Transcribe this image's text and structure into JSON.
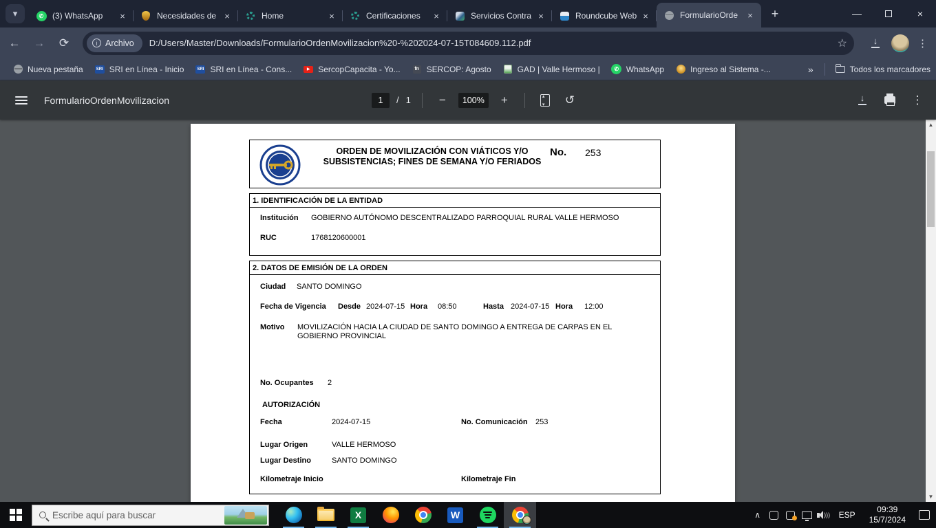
{
  "browser": {
    "tabs": [
      {
        "label": "(3) WhatsApp",
        "icon": "whatsapp"
      },
      {
        "label": "Necesidades de",
        "icon": "ecuador-crest"
      },
      {
        "label": "Home",
        "icon": "teal-gear"
      },
      {
        "label": "Certificaciones",
        "icon": "teal-gear"
      },
      {
        "label": "Servicios Contra",
        "icon": "emblem"
      },
      {
        "label": "Roundcube Web",
        "icon": "roundcube"
      },
      {
        "label": "FormularioOrde",
        "icon": "globe",
        "active": true
      }
    ],
    "address": {
      "chip_label": "Archivo",
      "url": "D:/Users/Master/Downloads/FormularioOrdenMovilizacion%20-%202024-07-15T084609.112.pdf"
    },
    "bookmarks": [
      {
        "label": "Nueva pestaña",
        "icon": "globe"
      },
      {
        "label": "SRI en Línea - Inicio",
        "icon": "sri"
      },
      {
        "label": "SRI en Línea - Cons...",
        "icon": "sri"
      },
      {
        "label": "SercopCapacita - Yo...",
        "icon": "youtube"
      },
      {
        "label": "SERCOP: Agosto",
        "icon": "fn"
      },
      {
        "label": "GAD | Valle Hermoso |",
        "icon": "gad"
      },
      {
        "label": "WhatsApp",
        "icon": "whatsapp"
      },
      {
        "label": "Ingreso al Sistema -...",
        "icon": "ecuador-crest"
      }
    ],
    "bookmarks_overflow": "»",
    "all_bookmarks_label": "Todos los marcadores"
  },
  "pdf_viewer": {
    "title": "FormularioOrdenMovilizacion",
    "page_current": "1",
    "page_divider": "/",
    "page_total": "1",
    "zoom_level": "100%"
  },
  "document": {
    "header": {
      "title": "ORDEN DE MOVILIZACIÓN CON VIÁTICOS Y/O SUBSISTENCIAS; FINES DE SEMANA Y/O FERIADOS",
      "no_label": "No.",
      "no_value": "253",
      "logo_name": "contraloria-general-del-estado-ecuador"
    },
    "section1": {
      "title": "1. IDENTIFICACIÓN DE LA ENTIDAD",
      "institucion_label": "Institución",
      "institucion_value": "GOBIERNO AUTÓNOMO DESCENTRALIZADO PARROQUIAL RURAL VALLE HERMOSO",
      "ruc_label": "RUC",
      "ruc_value": "1768120600001"
    },
    "section2": {
      "title": "2. DATOS DE EMISIÓN DE LA ORDEN",
      "ciudad_label": "Ciudad",
      "ciudad_value": "SANTO DOMINGO",
      "vigencia_label": "Fecha de Vigencia",
      "desde_label": "Desde",
      "desde_value": "2024-07-15",
      "hora1_label": "Hora",
      "hora1_value": "08:50",
      "hasta_label": "Hasta",
      "hasta_value": "2024-07-15",
      "hora2_label": "Hora",
      "hora2_value": "12:00",
      "motivo_label": "Motivo",
      "motivo_value": "MOVILIZACIÓN HACIA LA CIUDAD DE SANTO DOMINGO A ENTREGA DE CARPAS EN EL GOBIERNO PROVINCIAL",
      "ocupantes_label": "No. Ocupantes",
      "ocupantes_value": "2",
      "autorizacion_title": "AUTORIZACIÓN",
      "fecha_label": "Fecha",
      "fecha_value": "2024-07-15",
      "comunicacion_label": "No. Comunicación",
      "comunicacion_value": "253",
      "origen_label": "Lugar Origen",
      "origen_value": "VALLE HERMOSO",
      "destino_label": "Lugar Destino",
      "destino_value": "SANTO DOMINGO",
      "km_inicio_label": "Kilometraje Inicio",
      "km_fin_label": "Kilometraje Fin"
    }
  },
  "taskbar": {
    "search_placeholder": "Escribe aquí para buscar",
    "language": "ESP",
    "time": "09:39",
    "date": "15/7/2024"
  },
  "colors": {
    "tab_strip_bg": "#1e2433",
    "toolbar_bg": "#3c4456",
    "pdf_toolbar_bg": "#323639",
    "pdf_area_bg": "#525659",
    "taskbar_bg": "#0d0e11",
    "taskbar_accent": "#76b9ed",
    "whatsapp_green": "#25d366"
  }
}
